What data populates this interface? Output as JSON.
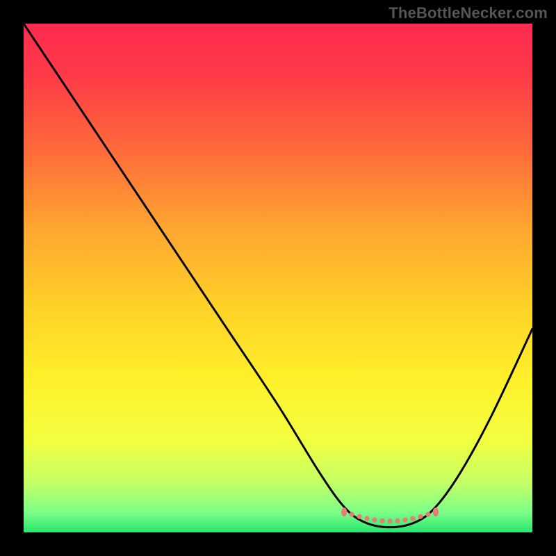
{
  "attribution": "TheBottleNecker.com",
  "chart_data": {
    "type": "line",
    "title": "",
    "xlabel": "",
    "ylabel": "",
    "xlim": [
      0,
      100
    ],
    "ylim": [
      0,
      100
    ],
    "legend": false,
    "grid": false,
    "curve": [
      {
        "x": 0,
        "y": 100
      },
      {
        "x": 10,
        "y": 85
      },
      {
        "x": 20,
        "y": 70
      },
      {
        "x": 30,
        "y": 55
      },
      {
        "x": 40,
        "y": 40
      },
      {
        "x": 50,
        "y": 25
      },
      {
        "x": 58,
        "y": 12
      },
      {
        "x": 63,
        "y": 5
      },
      {
        "x": 67,
        "y": 2
      },
      {
        "x": 72,
        "y": 1
      },
      {
        "x": 77,
        "y": 2
      },
      {
        "x": 81,
        "y": 5
      },
      {
        "x": 86,
        "y": 12
      },
      {
        "x": 92,
        "y": 23
      },
      {
        "x": 100,
        "y": 40
      }
    ],
    "highlight_band": {
      "x_start": 63,
      "x_end": 81,
      "y": 4
    },
    "gradient_stops": [
      {
        "offset": 0.0,
        "color": "#ff2b4f"
      },
      {
        "offset": 0.1,
        "color": "#ff3a48"
      },
      {
        "offset": 0.25,
        "color": "#ff6b3a"
      },
      {
        "offset": 0.4,
        "color": "#ffa531"
      },
      {
        "offset": 0.55,
        "color": "#ffd028"
      },
      {
        "offset": 0.7,
        "color": "#fff02a"
      },
      {
        "offset": 0.82,
        "color": "#f2ff41"
      },
      {
        "offset": 0.9,
        "color": "#c6ff64"
      },
      {
        "offset": 0.96,
        "color": "#7dff88"
      },
      {
        "offset": 1.0,
        "color": "#28e66f"
      }
    ]
  }
}
